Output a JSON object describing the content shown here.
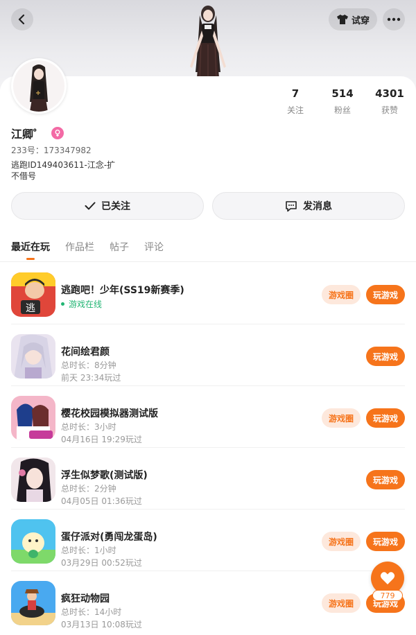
{
  "header": {
    "tryon_label": "试穿",
    "icons": {
      "back": "chevron-left-icon",
      "tryon": "shirt-icon",
      "more": "more-dots-icon"
    }
  },
  "profile": {
    "username": "江卿゜",
    "uid_label": "233号：173347982",
    "bio_line1": "逃跑ID149403611-江念-扩",
    "bio_line2": "不借号",
    "gender": "female"
  },
  "stats": [
    {
      "value": "7",
      "label": "关注"
    },
    {
      "value": "514",
      "label": "粉丝"
    },
    {
      "value": "4301",
      "label": "获赞"
    }
  ],
  "actions": {
    "follow_label": "已关注",
    "message_label": "发消息"
  },
  "tabs": [
    {
      "label": "最近在玩",
      "active": true
    },
    {
      "label": "作品栏",
      "active": false
    },
    {
      "label": "帖子",
      "active": false
    },
    {
      "label": "评论",
      "active": false
    }
  ],
  "games": [
    {
      "name": "逃跑吧！少年(SS19新赛季)",
      "status": "游戏在线",
      "circle_label": "游戏圈",
      "play_label": "玩游戏"
    },
    {
      "name": "花间绘君颜",
      "duration": "总时长：8分钟",
      "last_played": "前天 23:34玩过",
      "play_label": "玩游戏"
    },
    {
      "name": "樱花校园模拟器测试版",
      "duration": "总时长：3小时",
      "last_played": "04月16日 19:29玩过",
      "circle_label": "游戏圈",
      "play_label": "玩游戏"
    },
    {
      "name": "浮生似梦歌(测试版)",
      "duration": "总时长：2分钟",
      "last_played": "04月05日 01:36玩过",
      "play_label": "玩游戏"
    },
    {
      "name": "蛋仔派对(勇闯龙蛋岛)",
      "duration": "总时长：1小时",
      "last_played": "03月29日 00:52玩过",
      "circle_label": "游戏圈",
      "play_label": "玩游戏"
    },
    {
      "name": "疯狂动物园",
      "duration": "总时长：14小时",
      "last_played": "03月13日 10:08玩过",
      "circle_label": "游戏圈",
      "play_label": "玩游戏"
    }
  ],
  "like_fab": {
    "count": "779",
    "icon": "heart-icon"
  },
  "colors": {
    "accent": "#f6741b",
    "online": "#22b573",
    "gender_female": "#f36aa5"
  }
}
